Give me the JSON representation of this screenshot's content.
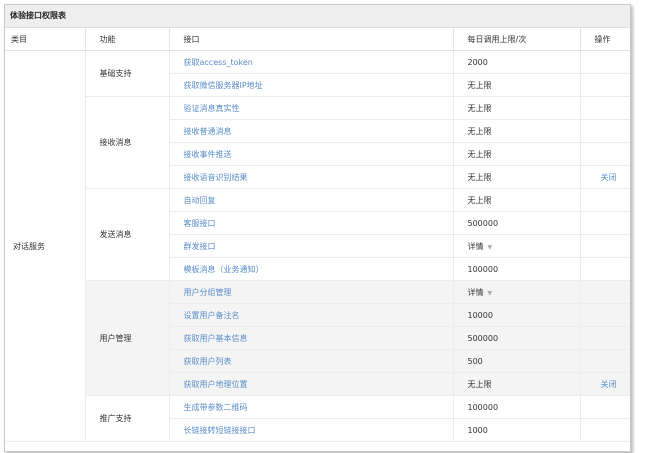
{
  "panel_title": "体验接口权限表",
  "columns": [
    "类目",
    "功能",
    "接口",
    "每日调用上限/次",
    "操作"
  ],
  "category": "对话服务",
  "groups": [
    {
      "name": "基础支持",
      "items": [
        {
          "api": "获取access_token",
          "limit": "2000",
          "op": ""
        },
        {
          "api": "获取微信服务器IP地址",
          "limit": "无上限",
          "op": ""
        }
      ]
    },
    {
      "name": "接收消息",
      "items": [
        {
          "api": "验证消息真实性",
          "limit": "无上限",
          "op": ""
        },
        {
          "api": "接收普通消息",
          "limit": "无上限",
          "op": ""
        },
        {
          "api": "接收事件推送",
          "limit": "无上限",
          "op": ""
        },
        {
          "api": "接收语音识别结果",
          "limit": "无上限",
          "op": "关闭"
        }
      ]
    },
    {
      "name": "发送消息",
      "items": [
        {
          "api": "自动回复",
          "limit": "无上限",
          "op": ""
        },
        {
          "api": "客服接口",
          "limit": "500000",
          "op": ""
        },
        {
          "api": "群发接口",
          "limit": "详情",
          "op": "",
          "dropdown": true
        },
        {
          "api": "模板消息（业务通知）",
          "limit": "100000",
          "op": ""
        }
      ]
    },
    {
      "name": "用户管理",
      "shaded": true,
      "items": [
        {
          "api": "用户分组管理",
          "limit": "详情",
          "op": "",
          "dropdown": true
        },
        {
          "api": "设置用户备注名",
          "limit": "10000",
          "op": ""
        },
        {
          "api": "获取用户基本信息",
          "limit": "500000",
          "op": ""
        },
        {
          "api": "获取用户列表",
          "limit": "500",
          "op": ""
        },
        {
          "api": "获取用户地理位置",
          "limit": "无上限",
          "op": "关闭"
        }
      ]
    },
    {
      "name": "推广支持",
      "items": [
        {
          "api": "生成带参数二维码",
          "limit": "100000",
          "op": ""
        },
        {
          "api": "长链接转短链接接口",
          "limit": "1000",
          "op": ""
        }
      ]
    }
  ],
  "colors": {
    "link": "#5a8cc9",
    "header_bg": "#eeeeee",
    "shaded_bg": "#f4f4f4",
    "border": "#e2e2e2"
  }
}
